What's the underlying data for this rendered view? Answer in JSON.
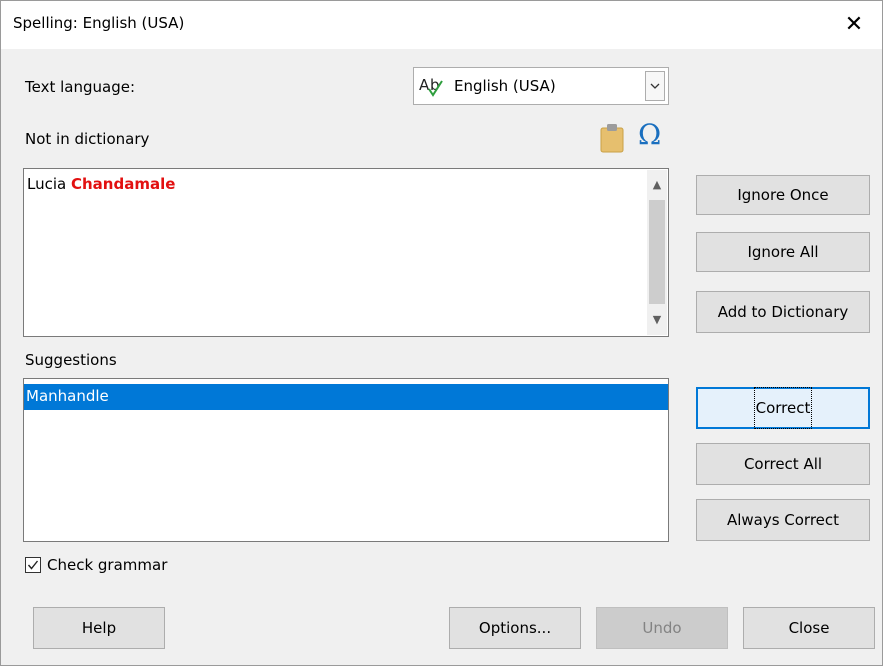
{
  "window": {
    "title": "Spelling: English (USA)",
    "close_glyph": "✕"
  },
  "language": {
    "label": "Text language:",
    "selected": "English (USA)",
    "icon": "spellcheck-abc-icon"
  },
  "not_in_dictionary": {
    "label": "Not in dictionary",
    "text_before": "Lucia ",
    "misspelled_word": "Chandamale",
    "error_color": "#e21010",
    "icons": [
      "paste-icon",
      "special-character-omega-icon"
    ],
    "omega_glyph": "Ω"
  },
  "suggestions": {
    "label": "Suggestions",
    "items": [
      "Manhandle"
    ],
    "selected_index": 0,
    "selection_color": "#0078d7"
  },
  "side_buttons": {
    "ignore_once": "Ignore Once",
    "ignore_all": "Ignore All",
    "add_to_dictionary": "Add to Dictionary",
    "correct": "Correct",
    "correct_all": "Correct All",
    "always_correct": "Always Correct"
  },
  "check_grammar": {
    "label": "Check grammar",
    "checked": true
  },
  "bottom_buttons": {
    "help": "Help",
    "options": "Options...",
    "undo": "Undo",
    "close": "Close"
  }
}
